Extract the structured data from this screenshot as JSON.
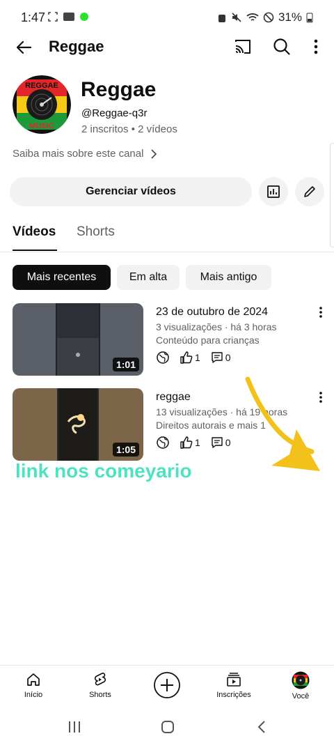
{
  "status": {
    "time": "1:47",
    "battery": "31%"
  },
  "header": {
    "title": "Reggae"
  },
  "channel": {
    "avatar_text_top": "REGGAE",
    "avatar_text_bottom": "MUSIC",
    "name": "Reggae",
    "handle": "@Reggae-q3r",
    "meta": "2 inscritos • 2 vídeos",
    "more_about": "Saiba mais sobre este canal",
    "manage_label": "Gerenciar vídeos"
  },
  "tabs": [
    {
      "label": "Vídeos",
      "active": true
    },
    {
      "label": "Shorts",
      "active": false
    }
  ],
  "chips": [
    {
      "label": "Mais recentes",
      "selected": true
    },
    {
      "label": "Em alta",
      "selected": false
    },
    {
      "label": "Mais antigo",
      "selected": false
    }
  ],
  "videos": [
    {
      "title": "23 de outubro de 2024",
      "meta": "3 visualizações · há 3 horas",
      "sub": "Conteúdo para crianças",
      "likes": "1",
      "comments": "0",
      "duration": "1:01"
    },
    {
      "title": "reggae",
      "meta": "13 visualizações · há 19 horas",
      "sub": "Direitos autorais e mais 1",
      "likes": "1",
      "comments": "0",
      "duration": "1:05"
    }
  ],
  "overlay": {
    "text": "link nos comeyario",
    "color": "#4de3c2",
    "arrow_color": "#f2c21b"
  },
  "bottom_nav": {
    "home": "Início",
    "shorts": "Shorts",
    "subscriptions": "Inscrições",
    "you": "Você"
  }
}
